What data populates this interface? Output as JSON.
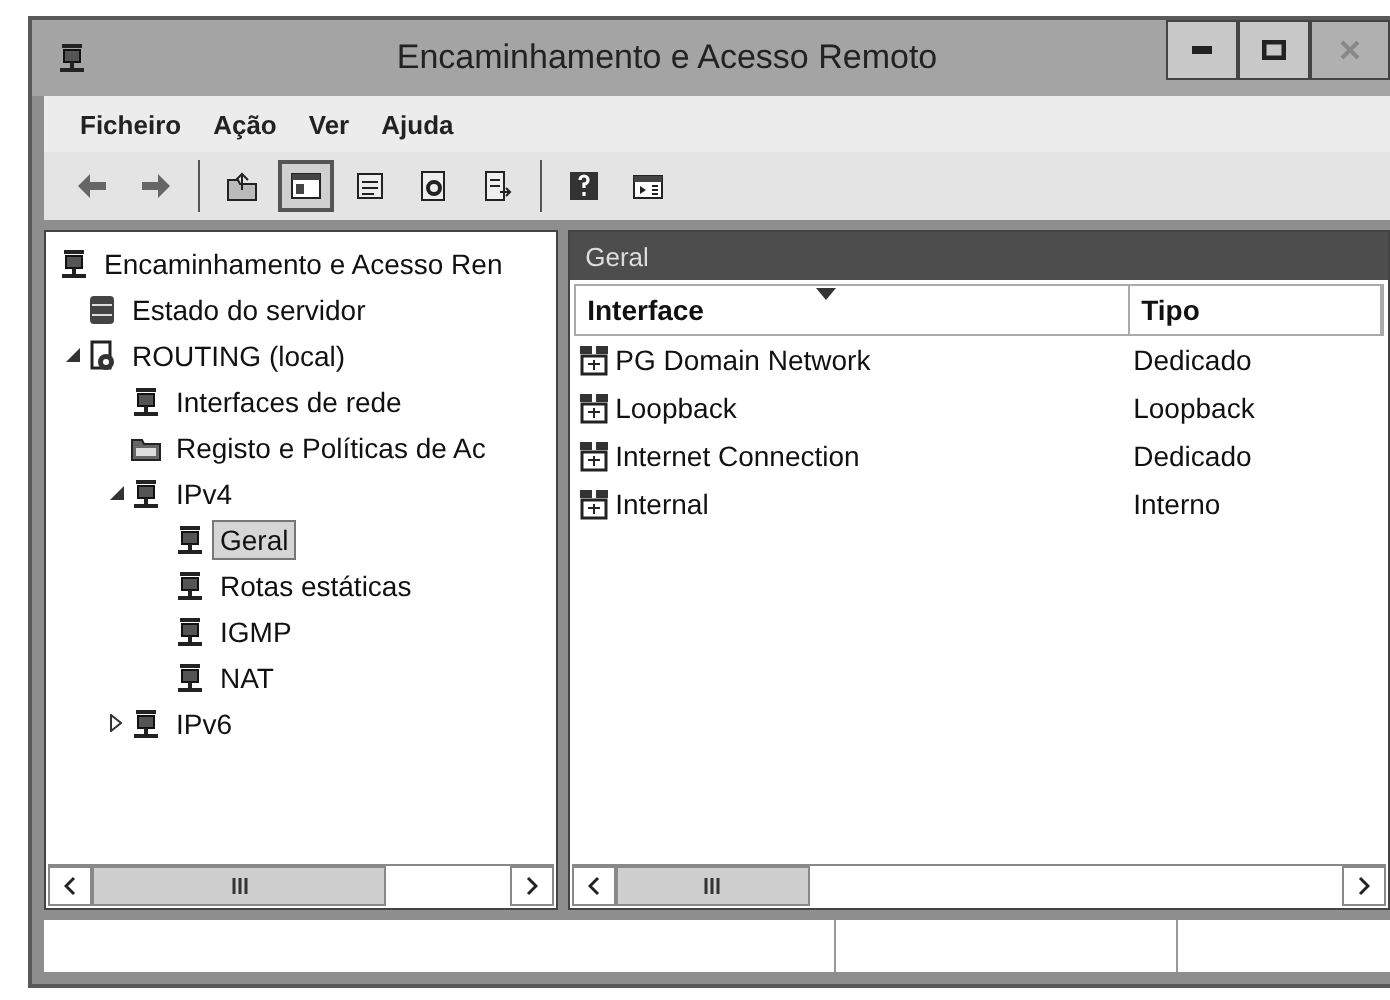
{
  "window": {
    "title": "Encaminhamento e Acesso Remoto"
  },
  "menu": [
    "Ficheiro",
    "Ação",
    "Ver",
    "Ajuda"
  ],
  "toolbar": [
    {
      "kind": "back",
      "pressed": false
    },
    {
      "kind": "forward",
      "pressed": false
    },
    {
      "kind": "separator"
    },
    {
      "kind": "up",
      "pressed": false
    },
    {
      "kind": "tree",
      "pressed": true
    },
    {
      "kind": "properties",
      "pressed": false
    },
    {
      "kind": "refresh",
      "pressed": false
    },
    {
      "kind": "export",
      "pressed": false
    },
    {
      "kind": "separator"
    },
    {
      "kind": "help",
      "pressed": false
    },
    {
      "kind": "pane",
      "pressed": false
    }
  ],
  "tree": [
    {
      "label": "Encaminhamento e Acesso Ren",
      "kind": "router",
      "selected": false,
      "children": [
        {
          "label": "Estado do servidor",
          "kind": "database",
          "selected": false
        },
        {
          "label": "ROUTING (local)",
          "kind": "server",
          "selected": false,
          "expanded": true,
          "children": [
            {
              "label": "Interfaces de rede",
              "kind": "router",
              "selected": false
            },
            {
              "label": "Registo e Políticas de Ac",
              "kind": "folder",
              "selected": false
            },
            {
              "label": "IPv4",
              "kind": "router",
              "selected": false,
              "expanded": true,
              "children": [
                {
                  "label": "Geral",
                  "kind": "router",
                  "selected": true
                },
                {
                  "label": "Rotas estáticas",
                  "kind": "router",
                  "selected": false
                },
                {
                  "label": "IGMP",
                  "kind": "router",
                  "selected": false
                },
                {
                  "label": "NAT",
                  "kind": "router",
                  "selected": false
                }
              ]
            },
            {
              "label": "IPv6",
              "kind": "router",
              "selected": false,
              "expanded": false
            }
          ]
        }
      ]
    }
  ],
  "details": {
    "title": "Geral",
    "columns": [
      "Interface",
      "Tipo"
    ],
    "rows": [
      {
        "interface": "PG Domain Network",
        "tipo": "Dedicado"
      },
      {
        "interface": "Loopback",
        "tipo": "Loopback"
      },
      {
        "interface": "Internet Connection",
        "tipo": "Dedicado"
      },
      {
        "interface": "Internal",
        "tipo": "Interno"
      }
    ]
  }
}
